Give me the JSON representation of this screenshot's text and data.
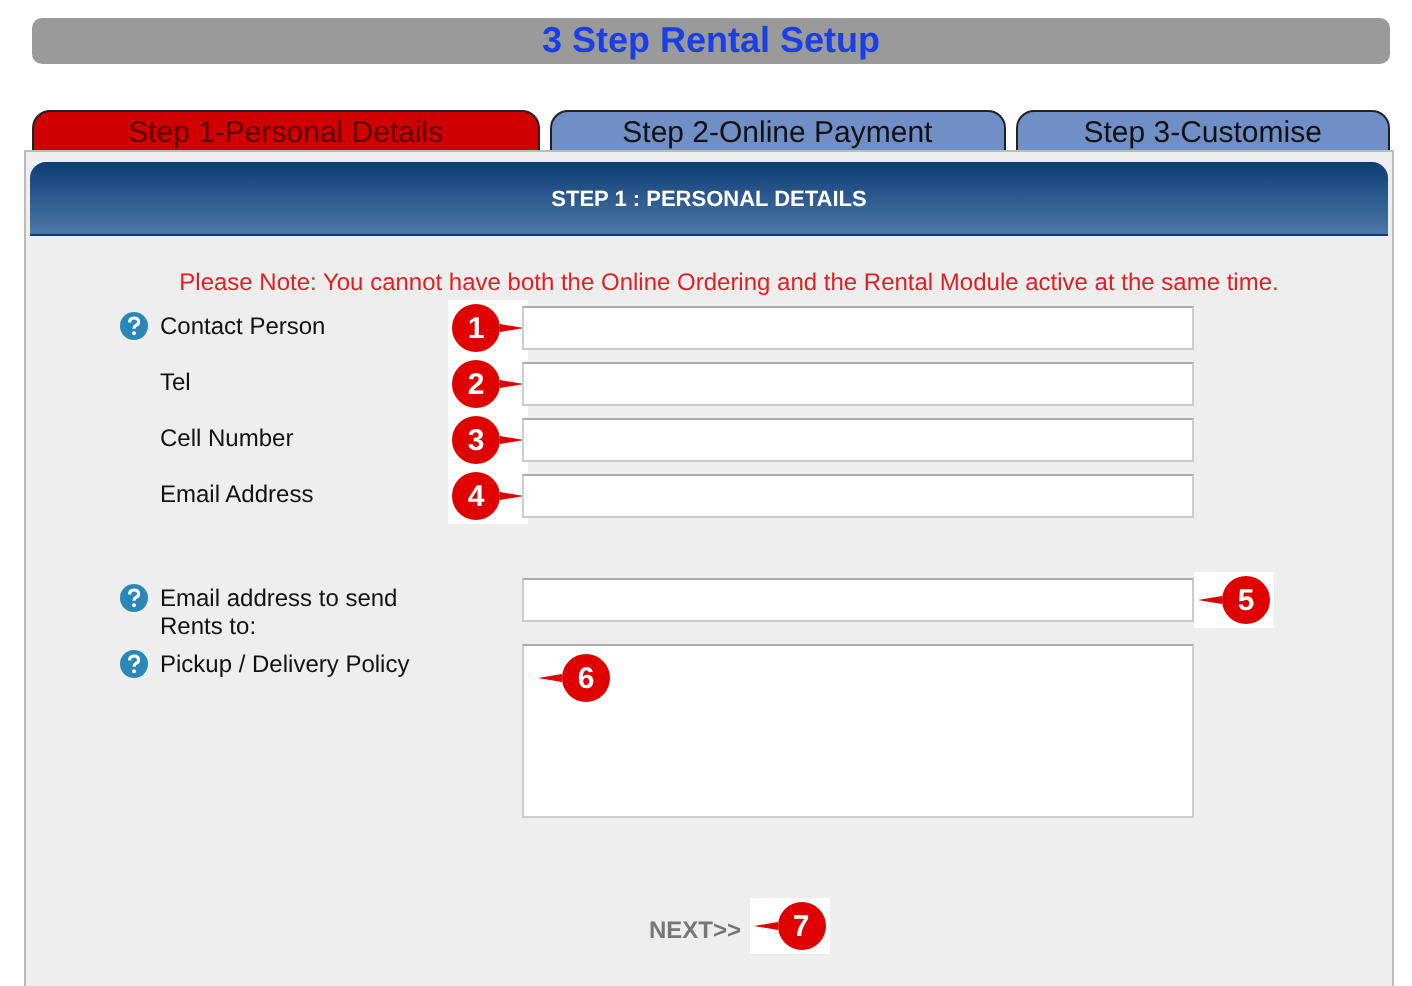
{
  "title": "3 Step Rental Setup",
  "tabs": [
    {
      "label": "Step 1-Personal Details",
      "selected": true
    },
    {
      "label": "Step 2-Online Payment",
      "selected": false
    },
    {
      "label": "Step 3-Customise",
      "selected": false
    }
  ],
  "panel": {
    "heading": "STEP 1 : PERSONAL DETAILS",
    "note": "Please Note: You cannot have both the Online Ordering and the Rental Module active at the same time."
  },
  "contact_fields": [
    {
      "label": "Contact Person",
      "help": true,
      "marker": "1"
    },
    {
      "label": "Tel",
      "help": false,
      "marker": "2"
    },
    {
      "label": "Cell Number",
      "help": false,
      "marker": "3"
    },
    {
      "label": "Email Address",
      "help": false,
      "marker": "4"
    }
  ],
  "rental_fields": [
    {
      "label": "Email address to send Rents to:",
      "kind": "input",
      "help": true,
      "marker": "5"
    },
    {
      "label": "Pickup / Delivery Policy",
      "kind": "textarea",
      "help": true,
      "marker": "6"
    }
  ],
  "next": {
    "label": "NEXT>>",
    "marker": "7"
  }
}
